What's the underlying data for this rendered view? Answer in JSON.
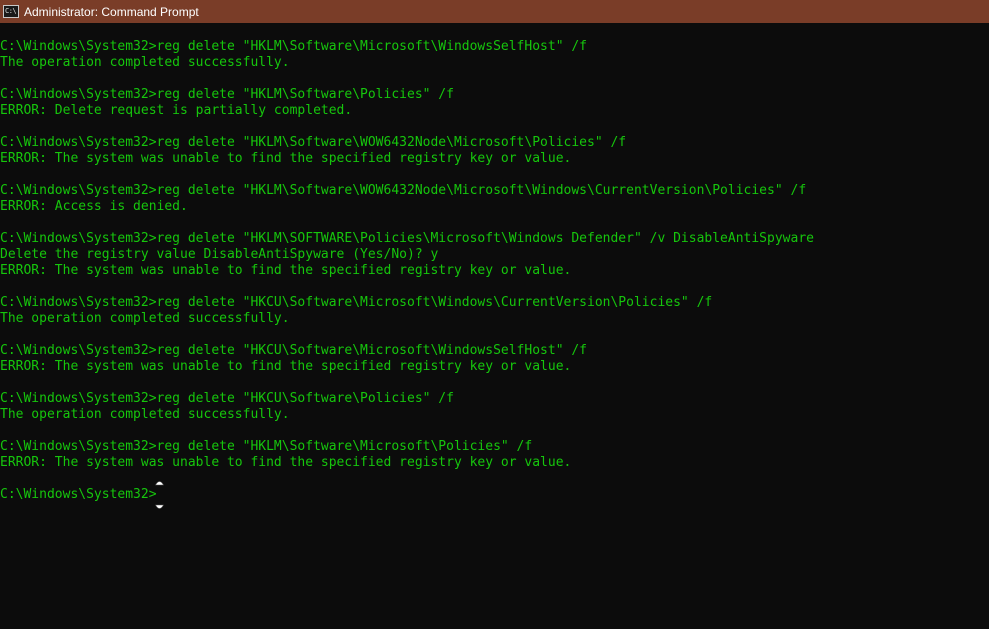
{
  "window": {
    "title": "Administrator: Command Prompt",
    "icon_text": "C:\\"
  },
  "theme": {
    "text_color": "#16c60c",
    "background": "#0c0c0c",
    "titlebar_color": "#7a3d28"
  },
  "console": {
    "lines": [
      "C:\\Windows\\System32>reg delete \"HKLM\\Software\\Microsoft\\WindowsSelfHost\" /f",
      "The operation completed successfully.",
      "",
      "C:\\Windows\\System32>reg delete \"HKLM\\Software\\Policies\" /f",
      "ERROR: Delete request is partially completed.",
      "",
      "C:\\Windows\\System32>reg delete \"HKLM\\Software\\WOW6432Node\\Microsoft\\Policies\" /f",
      "ERROR: The system was unable to find the specified registry key or value.",
      "",
      "C:\\Windows\\System32>reg delete \"HKLM\\Software\\WOW6432Node\\Microsoft\\Windows\\CurrentVersion\\Policies\" /f",
      "ERROR: Access is denied.",
      "",
      "C:\\Windows\\System32>reg delete \"HKLM\\SOFTWARE\\Policies\\Microsoft\\Windows Defender\" /v DisableAntiSpyware",
      "Delete the registry value DisableAntiSpyware (Yes/No)? y",
      "ERROR: The system was unable to find the specified registry key or value.",
      "",
      "C:\\Windows\\System32>reg delete \"HKCU\\Software\\Microsoft\\Windows\\CurrentVersion\\Policies\" /f",
      "The operation completed successfully.",
      "",
      "C:\\Windows\\System32>reg delete \"HKCU\\Software\\Microsoft\\WindowsSelfHost\" /f",
      "ERROR: The system was unable to find the specified registry key or value.",
      "",
      "C:\\Windows\\System32>reg delete \"HKCU\\Software\\Policies\" /f",
      "The operation completed successfully.",
      "",
      "C:\\Windows\\System32>reg delete \"HKLM\\Software\\Microsoft\\Policies\" /f",
      "ERROR: The system was unable to find the specified registry key or value.",
      "",
      "C:\\Windows\\System32>"
    ]
  }
}
